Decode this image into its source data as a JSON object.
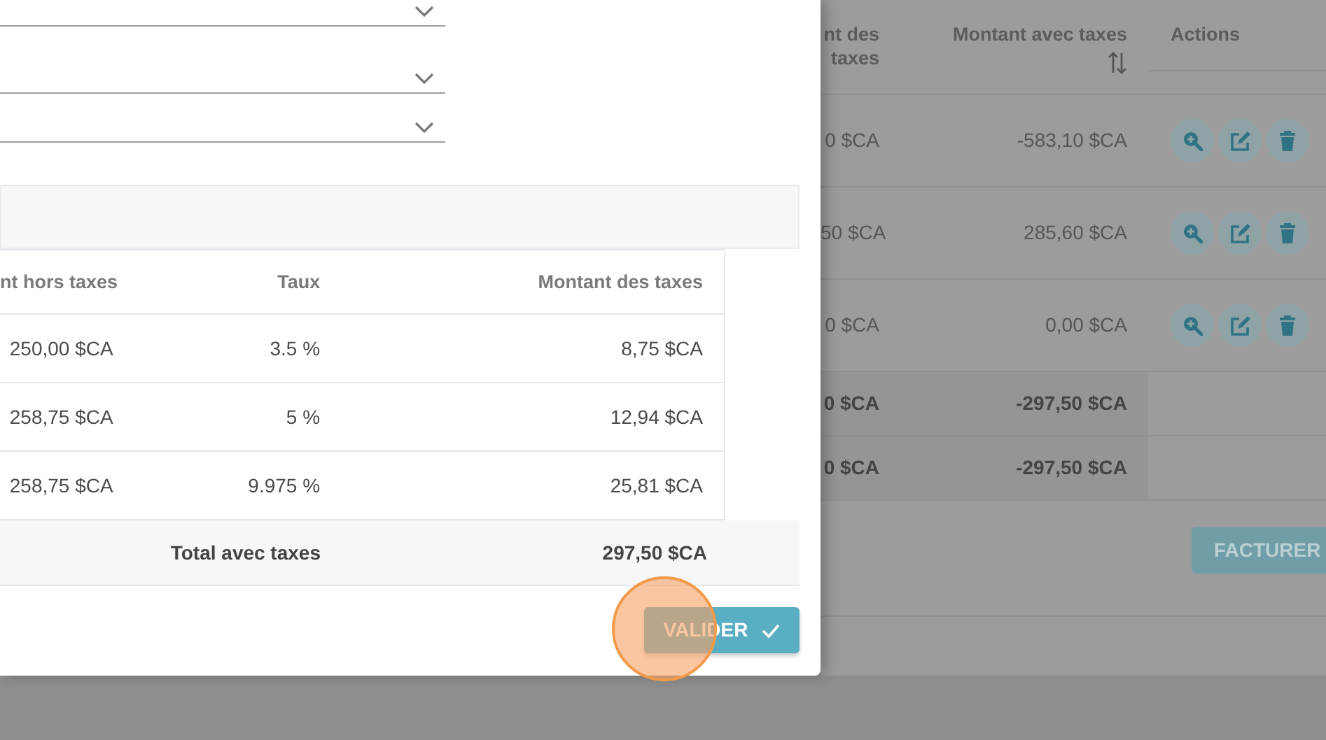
{
  "modal": {
    "fields": [
      {
        "kind": "select"
      },
      {
        "kind": "select"
      },
      {
        "kind": "select"
      }
    ],
    "tax_table": {
      "columns": [
        "nt hors taxes",
        "Taux",
        "Montant des taxes"
      ],
      "rows": [
        [
          "250,00 $CA",
          "3.5 %",
          "8,75 $CA"
        ],
        [
          "258,75 $CA",
          "5 %",
          "12,94 $CA"
        ],
        [
          "258,75 $CA",
          "9.975 %",
          "25,81 $CA"
        ]
      ],
      "total": {
        "label": "Total avec taxes",
        "value": "297,50 $CA"
      }
    },
    "validate_button": "VALIDER"
  },
  "background": {
    "columns": [
      {
        "label": "nt des taxes",
        "sortable": false
      },
      {
        "label": "Montant avec taxes",
        "sortable": true
      },
      {
        "label": "Actions",
        "sortable": false
      }
    ],
    "rows": [
      {
        "cells": [
          "0 $CA",
          "-583,10 $CA"
        ]
      },
      {
        "cells": [
          "50 $CA",
          "285,60 $CA"
        ]
      },
      {
        "cells": [
          "0 $CA",
          "0,00 $CA"
        ]
      }
    ],
    "totals": [
      [
        "0 $CA",
        "-297,50 $CA"
      ],
      [
        "0 $CA",
        "-297,50 $CA"
      ]
    ],
    "invoice_button": "FACTURER"
  }
}
